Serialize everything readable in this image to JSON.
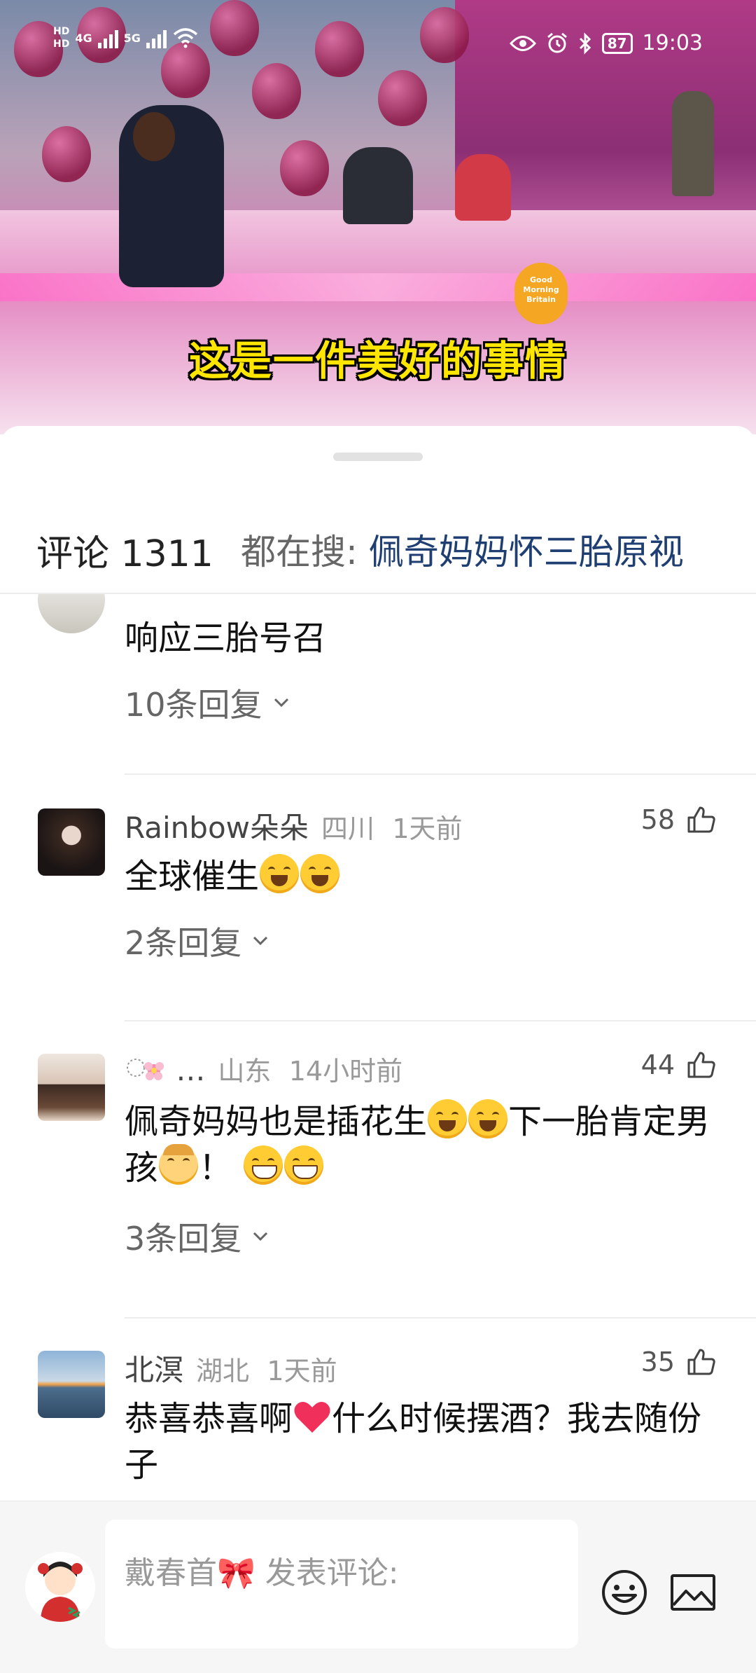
{
  "status_bar": {
    "hd1": "HD",
    "hd2": "HD",
    "net1": "4G",
    "net2": "5G",
    "battery": "87",
    "time": "19:03"
  },
  "video": {
    "subtitle": "这是一件美好的事情",
    "show_logo_line1": "Good",
    "show_logo_line2": "Morning",
    "show_logo_line3": "Britain"
  },
  "sheet": {
    "comment_count_label": "评论 1311",
    "hot_search_label": "都在搜: ",
    "hot_search_query": "佩奇妈妈怀三胎原视"
  },
  "comments": [
    {
      "name": "",
      "location": "",
      "time": "",
      "likes": "",
      "text": "响应三胎号召",
      "replies": "10条回复"
    },
    {
      "name": "Rainbow朵朵",
      "location": "四川",
      "time": "1天前",
      "likes": "58",
      "text": "全球催生",
      "replies": "2条回复"
    },
    {
      "name": "…",
      "location": "山东",
      "time": "14小时前",
      "likes": "44",
      "text_part1": "佩奇妈妈也是插花生",
      "text_part2": "下一胎肯定男孩",
      "text_part3": "！ ",
      "replies": "3条回复"
    },
    {
      "name": "北溟",
      "location": "湖北",
      "time": "1天前",
      "likes": "35",
      "text_part1": "恭喜恭喜啊",
      "text_part2": "什么时候摆酒？我去随份子",
      "replies": ""
    }
  ],
  "composer": {
    "placeholder": "戴春首🎀 发表评论:"
  },
  "icons": {
    "thumb": "thumbs-up-icon",
    "chevron": "chevron-down-icon",
    "emoji": "smiley-icon",
    "image": "image-icon"
  }
}
